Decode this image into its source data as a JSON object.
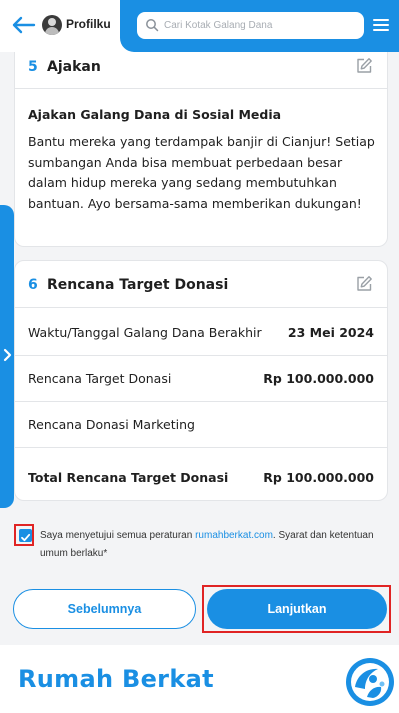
{
  "header": {
    "profile_label": "Profilku",
    "search_placeholder": "Cari Kotak Galang Dana"
  },
  "section5": {
    "number": "5",
    "title": "Ajakan",
    "subtitle": "Ajakan Galang Dana di Sosial Media",
    "body": "Bantu mereka yang terdampak banjir di Cianjur! Setiap sumbangan Anda bisa membuat perbedaan besar dalam hidup mereka yang sedang membutuhkan bantuan. Ayo bersama-sama memberikan dukungan!"
  },
  "section6": {
    "number": "6",
    "title": "Rencana Target Donasi",
    "rows": [
      {
        "label": "Waktu/Tanggal Galang Dana Berakhir",
        "value": "23 Mei 2024"
      },
      {
        "label": "Rencana Target Donasi",
        "value": "Rp 100.000.000"
      },
      {
        "label": "Rencana Donasi Marketing",
        "value": ""
      },
      {
        "label": "Total Rencana Target Donasi",
        "value": "Rp 100.000.000"
      }
    ]
  },
  "agreement": {
    "checked": true,
    "text_before": "Saya menyetujui semua peraturan ",
    "link": "rumahberkat.com",
    "text_after": ". Syarat dan ketentuan umum berlaku*"
  },
  "buttons": {
    "prev_label": "Sebelumnya",
    "next_label": "Lanjutkan"
  },
  "footer": {
    "brand": "Rumah Berkat"
  },
  "colors": {
    "primary": "#1a8fe3",
    "highlight": "#e02424"
  }
}
